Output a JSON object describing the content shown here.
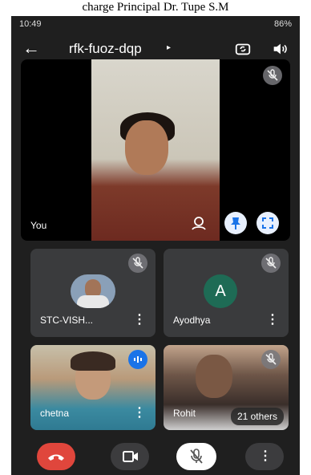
{
  "caption": "charge Principal Dr. Tupe S.M",
  "status_bar": {
    "left": "10:49",
    "right": "86%"
  },
  "app_bar": {
    "meeting_code": "rfk-fuoz-dqp",
    "caret": "▸",
    "back_icon": "arrow-left-icon",
    "camera_switch_icon": "camera-switch-icon",
    "speaker_icon": "speaker-icon"
  },
  "main_tile": {
    "label": "You"
  },
  "tiles": [
    {
      "name": "STC-VISH...",
      "muted": true,
      "more": "⋮"
    },
    {
      "name": "Ayodhya",
      "avatar_letter": "A",
      "avatar_color": "#1e6b55",
      "muted": true,
      "more": "⋮"
    },
    {
      "name": "chetna",
      "speaking": true,
      "more": "⋮"
    },
    {
      "name": "Rohit",
      "muted": true,
      "others": "21 others"
    }
  ],
  "call_controls": {
    "end_call_color": "#e0463c",
    "more": "⋮"
  }
}
